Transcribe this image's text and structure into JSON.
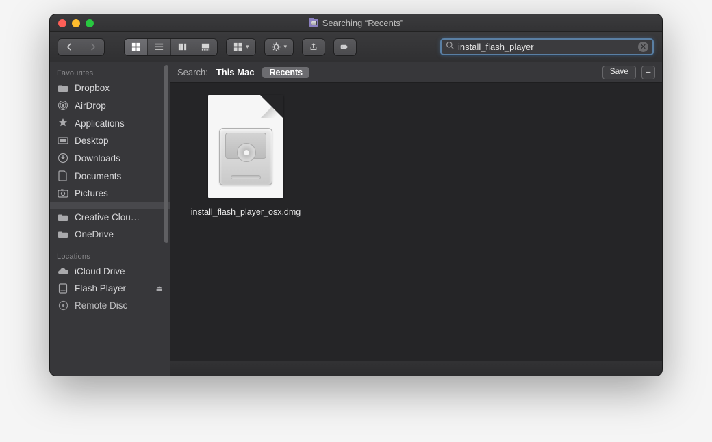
{
  "window": {
    "title_prefix": "Searching",
    "title_scope": "“Recents”"
  },
  "search": {
    "value": "install_flash_player"
  },
  "scopebar": {
    "label": "Search:",
    "opt_this_mac": "This Mac",
    "opt_recents": "Recents",
    "save_label": "Save"
  },
  "sidebar": {
    "section_favourites": "Favourites",
    "section_locations": "Locations",
    "favourites": [
      {
        "label": "Dropbox",
        "icon": "folder"
      },
      {
        "label": "AirDrop",
        "icon": "airdrop"
      },
      {
        "label": "Applications",
        "icon": "apps"
      },
      {
        "label": "Desktop",
        "icon": "desktop"
      },
      {
        "label": "Downloads",
        "icon": "downloads"
      },
      {
        "label": "Documents",
        "icon": "documents"
      },
      {
        "label": "Pictures",
        "icon": "pictures"
      },
      {
        "label": "",
        "icon": ""
      },
      {
        "label": "Creative Clou…",
        "icon": "folder"
      },
      {
        "label": "OneDrive",
        "icon": "folder"
      }
    ],
    "locations": [
      {
        "label": "iCloud Drive",
        "icon": "cloud"
      },
      {
        "label": "Flash Player",
        "icon": "disk",
        "eject": true
      },
      {
        "label": "Remote Disc",
        "icon": "remote"
      }
    ]
  },
  "results": [
    {
      "name": "install_flash_player_osx.dmg",
      "kind": "dmg"
    }
  ]
}
